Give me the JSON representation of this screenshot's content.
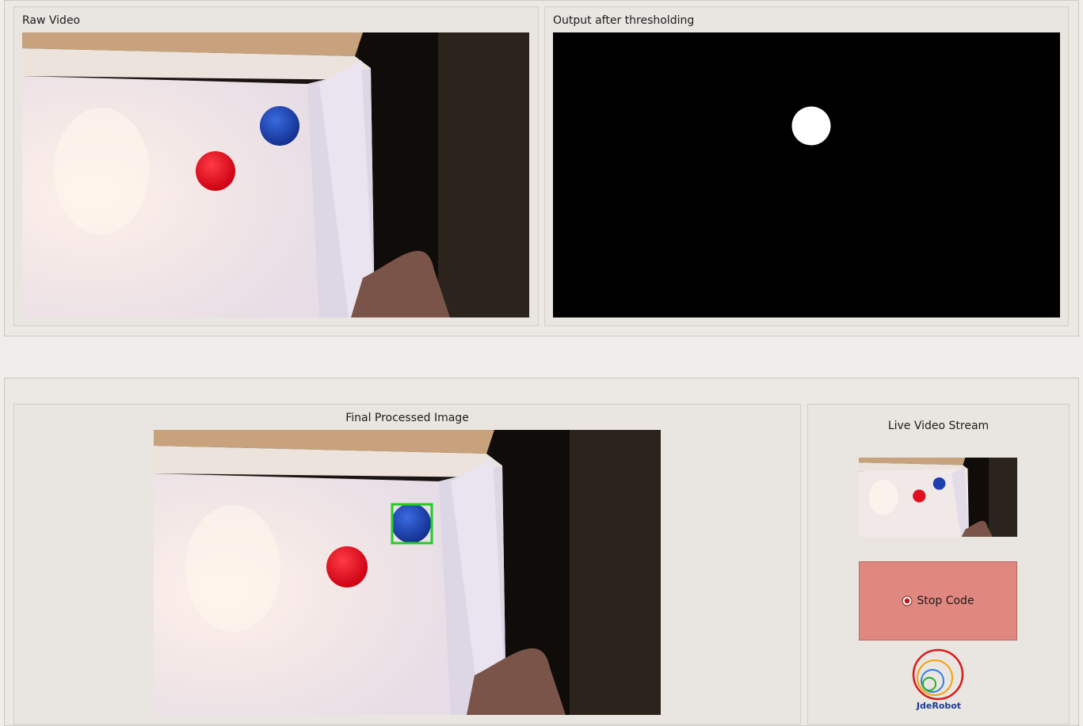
{
  "top_panels": {
    "raw_video": {
      "title": "Raw Video"
    },
    "threshold_output": {
      "title": "Output after thresholding"
    }
  },
  "bottom_panels": {
    "final_image": {
      "title": "Final Processed Image"
    },
    "live_stream": {
      "title": "Live Video Stream"
    }
  },
  "controls": {
    "stop_button": {
      "label": "Stop Code",
      "icon": "record-stop-icon",
      "color": "#e0877f"
    }
  },
  "logo": {
    "text": "JdeRobot",
    "icon": "jderobot-logo-icon"
  },
  "colors": {
    "window_bg": "#f0edea",
    "detection_box": "#22cc22",
    "red_ball": "#e0101e",
    "blue_ball": "#1c3fb0"
  }
}
